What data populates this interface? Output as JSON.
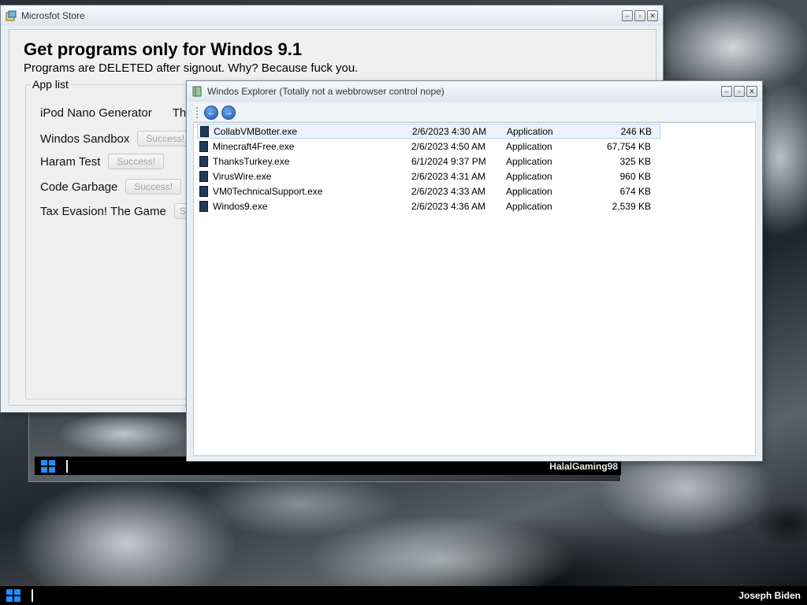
{
  "desktop": {
    "taskbar": {
      "user": "Joseph Biden"
    },
    "vm_taskbar": {
      "user": "HalalGaming98"
    }
  },
  "store": {
    "title": "Microsfot Store",
    "heading": "Get programs only for Windos 9.1",
    "subtitle": "Programs are DELETED after signout. Why? Because fuck you.",
    "app_list_label": "App list",
    "apps": [
      {
        "name": "iPod Nano Generator",
        "extra": "Thi"
      },
      {
        "name": "Windos Sandbox",
        "button": "Success!"
      },
      {
        "name": "Haram Test",
        "button": "Success!"
      },
      {
        "name": "Code Garbage",
        "button": "Success!"
      },
      {
        "name": "Tax Evasion! The Game",
        "button": "Su"
      }
    ]
  },
  "explorer": {
    "title": "Windos Explorer (Totally not a webbrowser control nope)",
    "nav": {
      "back": "back-icon",
      "forward": "forward-icon"
    },
    "files": [
      {
        "name": "CollabVMBotter.exe",
        "date": "2/6/2023 4:30 AM",
        "type": "Application",
        "size": "246 KB"
      },
      {
        "name": "Minecraft4Free.exe",
        "date": "2/6/2023 4:50 AM",
        "type": "Application",
        "size": "67,754 KB"
      },
      {
        "name": "ThanksTurkey.exe",
        "date": "6/1/2024 9:37 PM",
        "type": "Application",
        "size": "325 KB"
      },
      {
        "name": "VirusWire.exe",
        "date": "2/6/2023 4:31 AM",
        "type": "Application",
        "size": "960 KB"
      },
      {
        "name": "VM0TechnicalSupport.exe",
        "date": "2/6/2023 4:33 AM",
        "type": "Application",
        "size": "674 KB"
      },
      {
        "name": "Windos9.exe",
        "date": "2/6/2023 4:36 AM",
        "type": "Application",
        "size": "2,539 KB"
      }
    ]
  },
  "colors": {
    "accent": "#1e90ff",
    "selection": "#eaf3fc",
    "taskbar": "#000000"
  }
}
